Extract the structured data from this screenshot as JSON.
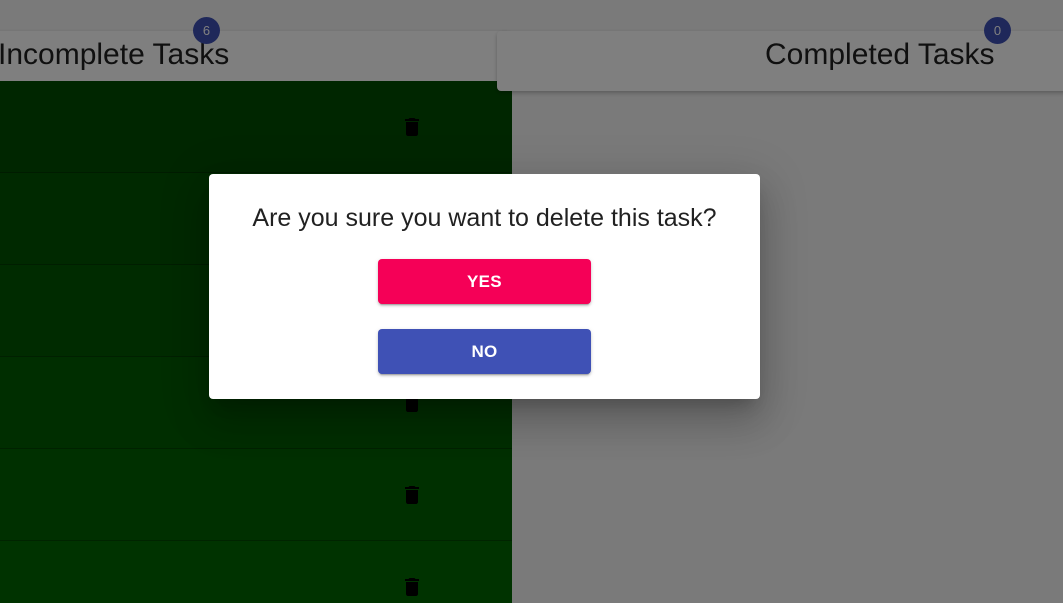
{
  "incomplete": {
    "title": "Incomplete Tasks",
    "count": "6",
    "tasks": [
      {
        "shade": "#004d00"
      },
      {
        "shade": "#005200"
      },
      {
        "shade": "#005700"
      },
      {
        "shade": "#005c00"
      },
      {
        "shade": "#006100"
      },
      {
        "shade": "#006600"
      }
    ]
  },
  "completed": {
    "title": "Completed Tasks",
    "count": "0"
  },
  "dialog": {
    "title": "Are you sure you want to delete this task?",
    "yes_label": "YES",
    "no_label": "NO"
  },
  "colors": {
    "yes": "#f50057",
    "no": "#3f51b5",
    "badge": "#3f51b5"
  },
  "icons": {
    "delete": "trash-icon"
  }
}
